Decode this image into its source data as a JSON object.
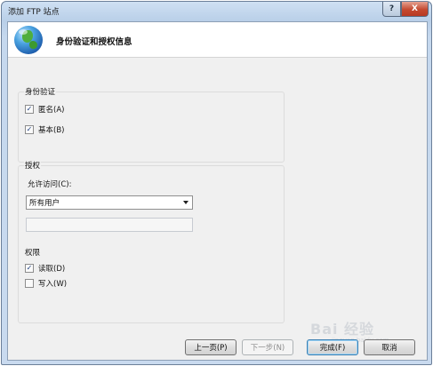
{
  "window": {
    "title": "添加 FTP 站点",
    "help_glyph": "?",
    "close_glyph": "X"
  },
  "header": {
    "title": "身份验证和授权信息",
    "icon": "globe-icon"
  },
  "authentication": {
    "label": "身份验证",
    "options": [
      {
        "label": "匿名(A)",
        "checked": true
      },
      {
        "label": "基本(B)",
        "checked": true
      }
    ]
  },
  "authorization": {
    "label": "授权",
    "allow_access_label": "允许访问(C):",
    "allow_access_value": "所有用户",
    "user_input_value": "",
    "permissions_label": "权限",
    "permissions": [
      {
        "label": "读取(D)",
        "checked": true
      },
      {
        "label": "写入(W)",
        "checked": false
      }
    ]
  },
  "buttons": {
    "back": "上一页(P)",
    "next": "下一步(N)",
    "finish": "完成(F)",
    "cancel": "取消"
  },
  "watermark": {
    "text": "Bai 经验",
    "sub": "jingyan.baidu.com"
  },
  "check_glyph": "✓"
}
